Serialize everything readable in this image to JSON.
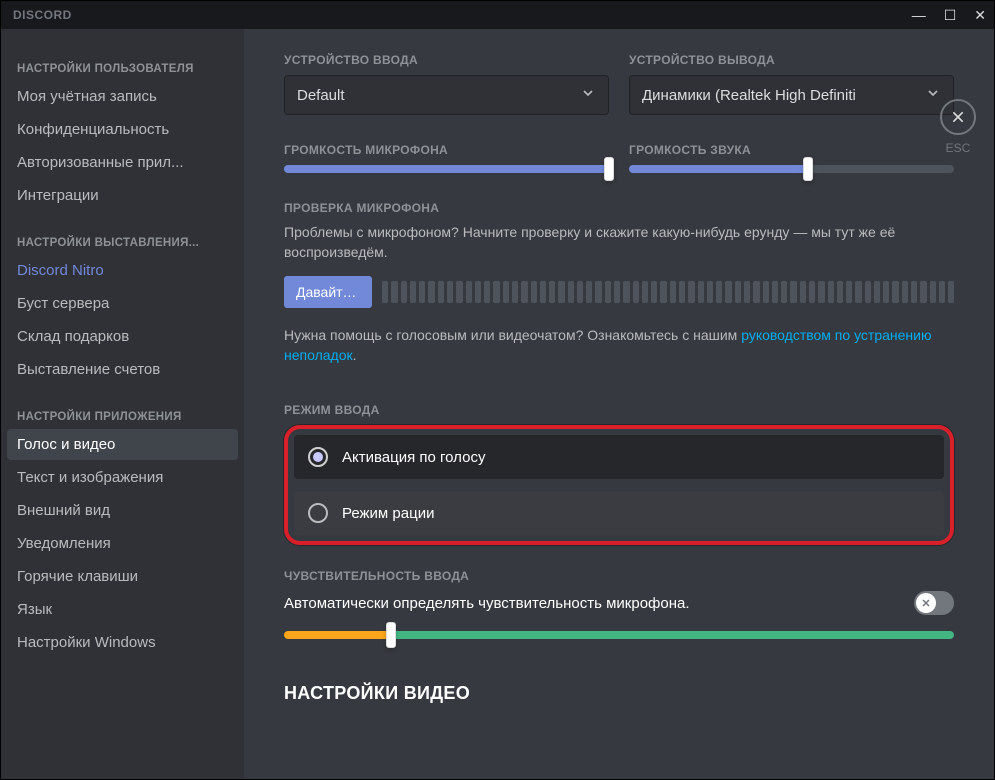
{
  "titlebar": {
    "brand": "DISCORD"
  },
  "esc_label": "ESC",
  "sidebar": {
    "sections": [
      {
        "header": "НАСТРОЙКИ ПОЛЬЗОВАТЕЛЯ",
        "items": [
          "Моя учётная запись",
          "Конфиденциальность",
          "Авторизованные прил...",
          "Интеграции"
        ]
      },
      {
        "header": "НАСТРОЙКИ ВЫСТАВЛЕНИЯ...",
        "items": [
          "Discord Nitro",
          "Буст сервера",
          "Склад подарков",
          "Выставление счетов"
        ]
      },
      {
        "header": "НАСТРОЙКИ ПРИЛОЖЕНИЯ",
        "items": [
          "Голос и видео",
          "Текст и изображения",
          "Внешний вид",
          "Уведомления",
          "Горячие клавиши",
          "Язык",
          "Настройки Windows"
        ]
      }
    ],
    "active": "Голос и видео",
    "link_item": "Discord Nitro"
  },
  "devices": {
    "input_label": "УСТРОЙСТВО ВВОДА",
    "input_value": "Default",
    "output_label": "УСТРОЙСТВО ВЫВОДА",
    "output_value": "Динамики (Realtek High Definiti"
  },
  "volumes": {
    "mic_label": "ГРОМКОСТЬ МИКРОФОНА",
    "mic_pct": 100,
    "out_label": "ГРОМКОСТЬ ЗВУКА",
    "out_pct": 55
  },
  "mic_test": {
    "header": "ПРОВЕРКА МИКРОФОНА",
    "desc": "Проблемы с микрофоном? Начните проверку и скажите какую-нибудь ерунду — мы тут же её воспроизведём.",
    "button": "Давайте пр...",
    "help_pre": "Нужна помощь с голосовым или видеочатом? Ознакомьтесь с нашим ",
    "help_link": "руководством по устранению неполадок",
    "help_post": "."
  },
  "input_mode": {
    "header": "РЕЖИМ ВВОДА",
    "option_voice": "Активация по голосу",
    "option_ptt": "Режим рации",
    "selected": "voice"
  },
  "sensitivity": {
    "header": "ЧУВСТВИТЕЛЬНОСТЬ ВВОДА",
    "auto_label": "Автоматически определять чувствительность микрофона.",
    "auto_on": false,
    "threshold_pct": 16
  },
  "video_header": "НАСТРОЙКИ ВИДЕО"
}
